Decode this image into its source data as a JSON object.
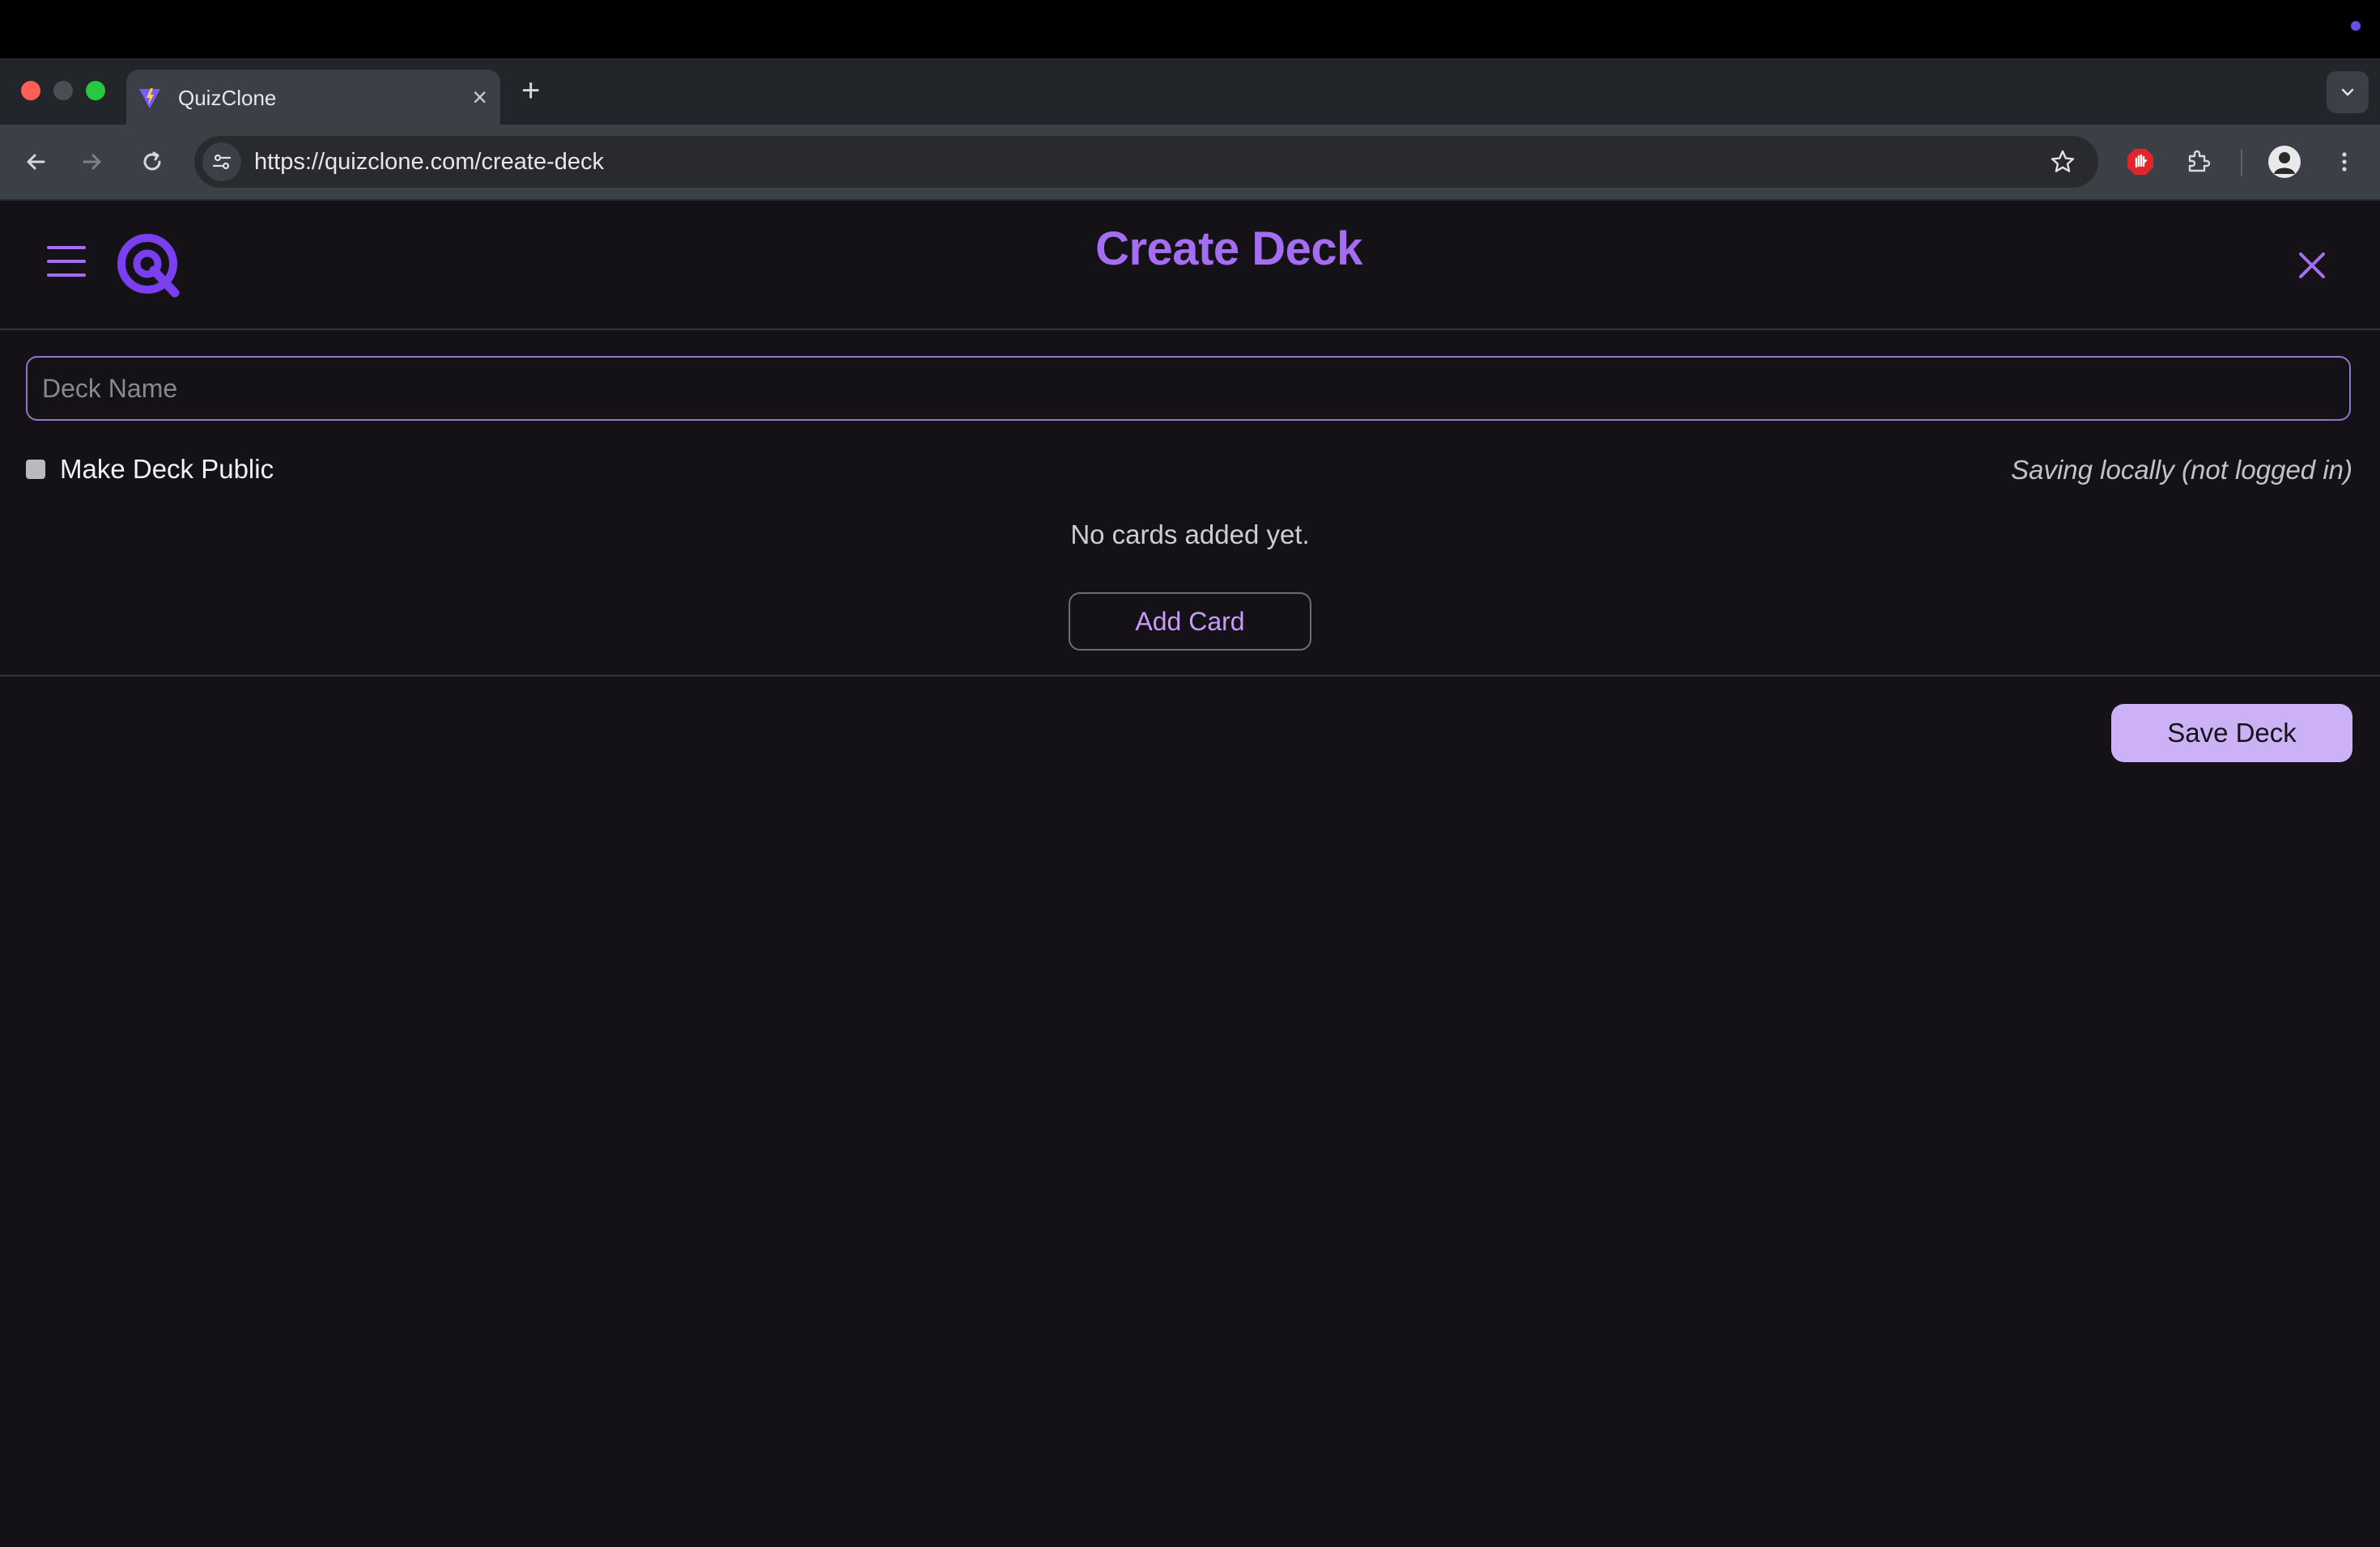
{
  "browser": {
    "tab_title": "QuizClone",
    "tab_close_icon": "×",
    "new_tab_icon": "+",
    "url": "https://quizclone.com/create-deck"
  },
  "app": {
    "title": "Create Deck",
    "deck_name_placeholder": "Deck Name",
    "deck_name_value": "",
    "make_public_label": "Make Deck Public",
    "make_public_checked": false,
    "saving_status": "Saving locally (not logged in)",
    "empty_message": "No cards added yet.",
    "add_card_label": "Add Card",
    "save_deck_label": "Save Deck"
  },
  "colors": {
    "accent": "#a56df2",
    "save_button": "#cdb1f6",
    "background": "#141217"
  }
}
